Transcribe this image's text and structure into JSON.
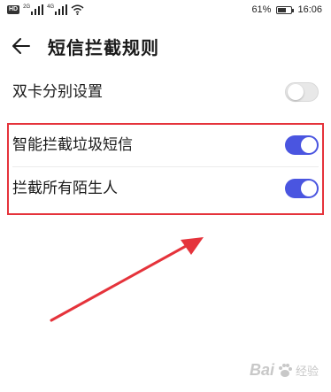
{
  "status_bar": {
    "network_badge": "HD",
    "net1": "2G",
    "net2": "4G",
    "battery_percent": "61%",
    "battery_level": 0.61,
    "time": "16:06"
  },
  "header": {
    "title": "短信拦截规则",
    "back_icon": "arrow-left-icon"
  },
  "settings": [
    {
      "label": "双卡分别设置",
      "enabled": false
    },
    {
      "label": "智能拦截垃圾短信",
      "enabled": true
    },
    {
      "label": "拦截所有陌生人",
      "enabled": true
    }
  ],
  "annotation": {
    "highlight_color": "#e5333b",
    "arrow_color": "#e5333b"
  },
  "colors": {
    "toggle_on": "#4a55e0",
    "toggle_off": "#e8e8e8"
  },
  "watermark": {
    "brand": "Bai",
    "sub": "经验",
    "url": "jingyan.baidu.com"
  }
}
